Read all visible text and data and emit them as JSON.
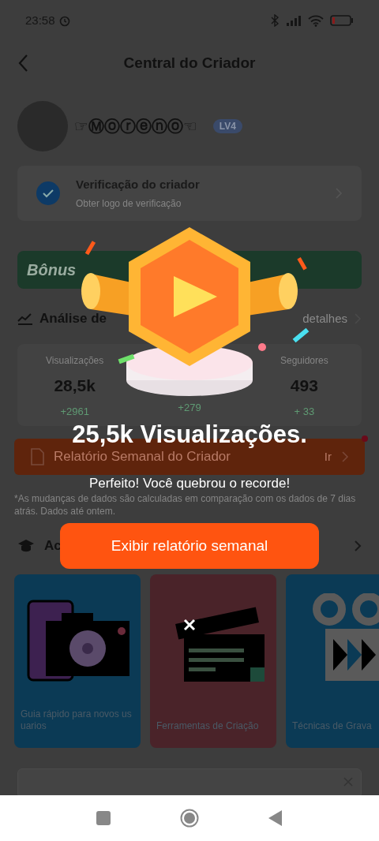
{
  "status_bar": {
    "time": "23:58"
  },
  "header": {
    "title": "Central do Criador"
  },
  "profile": {
    "name": "☞Ⓜⓞⓡⓔⓝⓞ☜",
    "level_badge": "LV4"
  },
  "verification": {
    "title": "Verificação do criador",
    "subtitle": "Obter logo de verificação"
  },
  "banner": {
    "text": "Bônus"
  },
  "analysis": {
    "title": "Análise de",
    "link": "detalhes"
  },
  "stats": [
    {
      "label": "Visualizações",
      "value": "28,5k",
      "change": "+2961"
    },
    {
      "change": "+279"
    },
    {
      "label": "Seguidores",
      "value": "493",
      "change": "+ 33"
    }
  ],
  "weekly_report": {
    "title": "Relatório Semanal do Criador",
    "action": "Ir",
    "unread": true
  },
  "footnote": "*As mudanças de dados são calculadas em comparação com os dados de 7 dias atrás. Dados até ontem.",
  "academy": {
    "title": "Ac"
  },
  "cards": [
    {
      "kind": "camera",
      "title": "Guia rápido para novos usuarios",
      "color": "#0b3a55"
    },
    {
      "kind": "clapper",
      "title": "Ferramentas de Criação",
      "color": "#4a2329"
    },
    {
      "kind": "video",
      "title": "Técnicas de Grava",
      "color": "#0b3a55"
    }
  ],
  "modal": {
    "title": "25,5k Visualizações.",
    "subtitle": "Perfeito! Você quebrou o recorde!",
    "button": "Exibir relatório semanal"
  }
}
